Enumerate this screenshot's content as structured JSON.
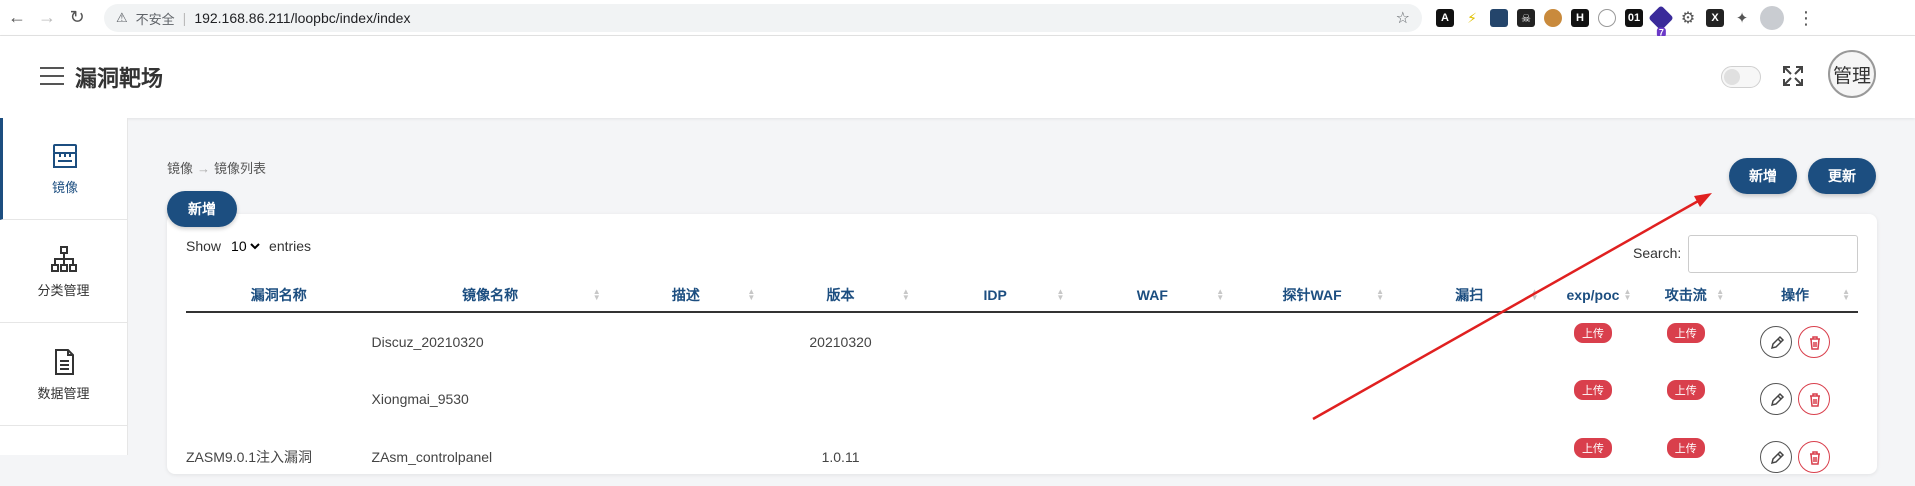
{
  "browser": {
    "warning_label": "不安全",
    "url": "192.168.86.211/loopbc/index/index",
    "extension_badge": "7",
    "ext_labels": [
      "A",
      "",
      "",
      "",
      "",
      "H",
      "",
      "01",
      "",
      "",
      "X",
      ""
    ]
  },
  "header": {
    "title": "漏洞靶场",
    "avatar_label": "管理"
  },
  "sidebar": {
    "items": [
      {
        "label": "镜像",
        "icon": "store-icon",
        "active": true
      },
      {
        "label": "分类管理",
        "icon": "hierarchy-icon",
        "active": false
      },
      {
        "label": "数据管理",
        "icon": "document-icon",
        "active": false
      }
    ]
  },
  "breadcrumb": {
    "parent": "镜像",
    "current": "镜像列表"
  },
  "toolbar": {
    "add_label": "新增",
    "top_add_label": "新增",
    "refresh_label": "更新"
  },
  "table": {
    "show_label": "Show",
    "entries_value": "10",
    "entries_label": "entries",
    "search_label": "Search:",
    "columns": [
      "漏洞名称",
      "镜像名称",
      "描述",
      "版本",
      "IDP",
      "WAF",
      "探针WAF",
      "漏扫",
      "exp/poc",
      "攻击流",
      "操作"
    ],
    "rows": [
      {
        "vuln_name": "",
        "image_name": "Discuz_20210320",
        "desc": "",
        "version": "20210320",
        "idp": "",
        "waf": "",
        "probe_waf": "",
        "scan": "",
        "exp_poc": "上传",
        "attack_flow": "上传"
      },
      {
        "vuln_name": "",
        "image_name": "Xiongmai_9530",
        "desc": "",
        "version": "",
        "idp": "",
        "waf": "",
        "probe_waf": "",
        "scan": "",
        "exp_poc": "上传",
        "attack_flow": "上传"
      },
      {
        "vuln_name": "ZASM9.0.1注入漏洞",
        "image_name": "ZAsm_controlpanel",
        "desc": "",
        "version": "1.0.11",
        "idp": "",
        "waf": "",
        "probe_waf": "",
        "scan": "",
        "exp_poc": "上传",
        "attack_flow": "上传"
      }
    ]
  },
  "colors": {
    "primary": "#1c4e80",
    "danger": "#d93f4c",
    "annotation_arrow": "#e02020"
  }
}
